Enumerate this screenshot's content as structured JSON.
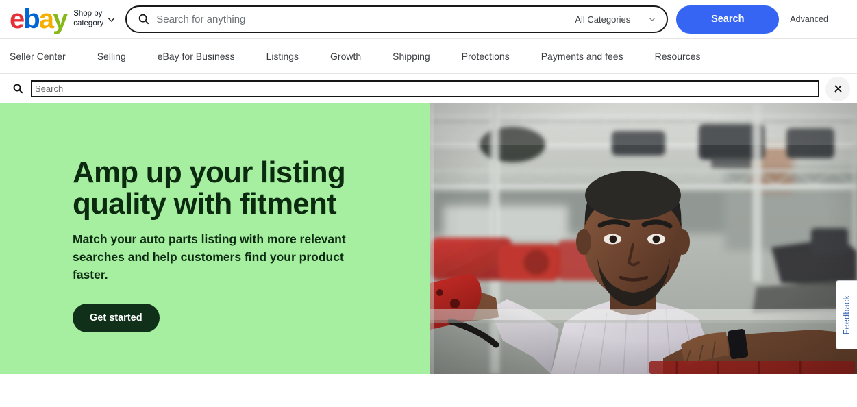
{
  "header": {
    "logo": {
      "letters": [
        "e",
        "b",
        "a",
        "y"
      ],
      "colors": [
        "#e53238",
        "#0064d2",
        "#f5af02",
        "#86b817"
      ]
    },
    "shop_by_line1": "Shop by",
    "shop_by_line2": "category",
    "chevron_icon": "chevron-down-icon",
    "search_icon": "search-icon",
    "search_placeholder": "Search for anything",
    "search_value": "",
    "category_selected": "All Categories",
    "category_chevron_icon": "chevron-down-icon",
    "search_button": "Search",
    "advanced_link": "Advanced",
    "accent_blue": "#3665f3"
  },
  "nav": {
    "items": [
      {
        "label": "Seller Center"
      },
      {
        "label": "Selling"
      },
      {
        "label": "eBay for Business"
      },
      {
        "label": "Listings"
      },
      {
        "label": "Growth"
      },
      {
        "label": "Shipping"
      },
      {
        "label": "Protections"
      },
      {
        "label": "Payments and fees"
      },
      {
        "label": "Resources"
      }
    ]
  },
  "search_row": {
    "icon": "search-icon",
    "placeholder": "Search",
    "value": "",
    "close_icon": "close-icon"
  },
  "hero": {
    "background_color": "#a6efa0",
    "heading": "Amp up your listing quality with fitment",
    "subheading": "Match your auto parts listing with more relevant searches and help customers find your product faster.",
    "cta_label": "Get started",
    "cta_color": "#10301a",
    "image_alt": "Man holding a red brake caliper beside warehouse shelving stocked with auto parts"
  },
  "feedback": {
    "label": "Feedback",
    "color": "#3665b3"
  }
}
